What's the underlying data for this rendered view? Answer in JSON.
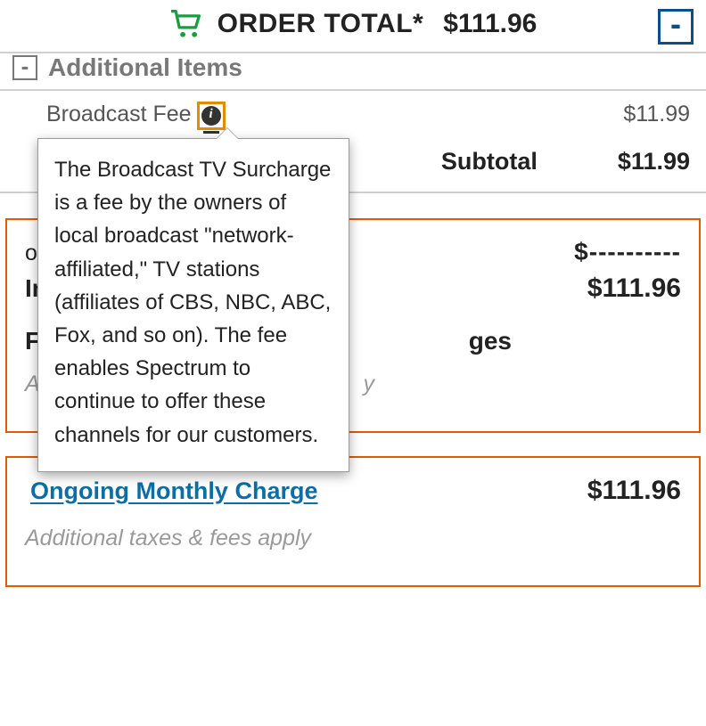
{
  "header": {
    "label": "ORDER TOTAL*",
    "value": "$111.96",
    "collapse": "-"
  },
  "section": {
    "collapse": "-",
    "title": "Additional Items"
  },
  "broadcast": {
    "label": "Broadcast Fee",
    "value": "$11.99"
  },
  "subtotal": {
    "label": "Subtotal",
    "value": "$11.99"
  },
  "tooltip": {
    "text": "The Broadcast TV Surcharge is a fee by the owners of local broadcast \"network-affiliated,\" TV stations (affiliates of CBS, NBC, ABC, Fox, and so on). The fee enables Spectrum to continue to offer these channels for our customers."
  },
  "card1": {
    "one_label": "one",
    "one_value": "$----------",
    "init_label": "Ini",
    "init_value": "$111.96",
    "subhead": "Fir",
    "subhead_right": "ges",
    "note": "Ad",
    "note_right": "y"
  },
  "card2": {
    "link": "Ongoing Monthly Charge",
    "value": "$111.96",
    "note": "Additional taxes & fees apply"
  }
}
